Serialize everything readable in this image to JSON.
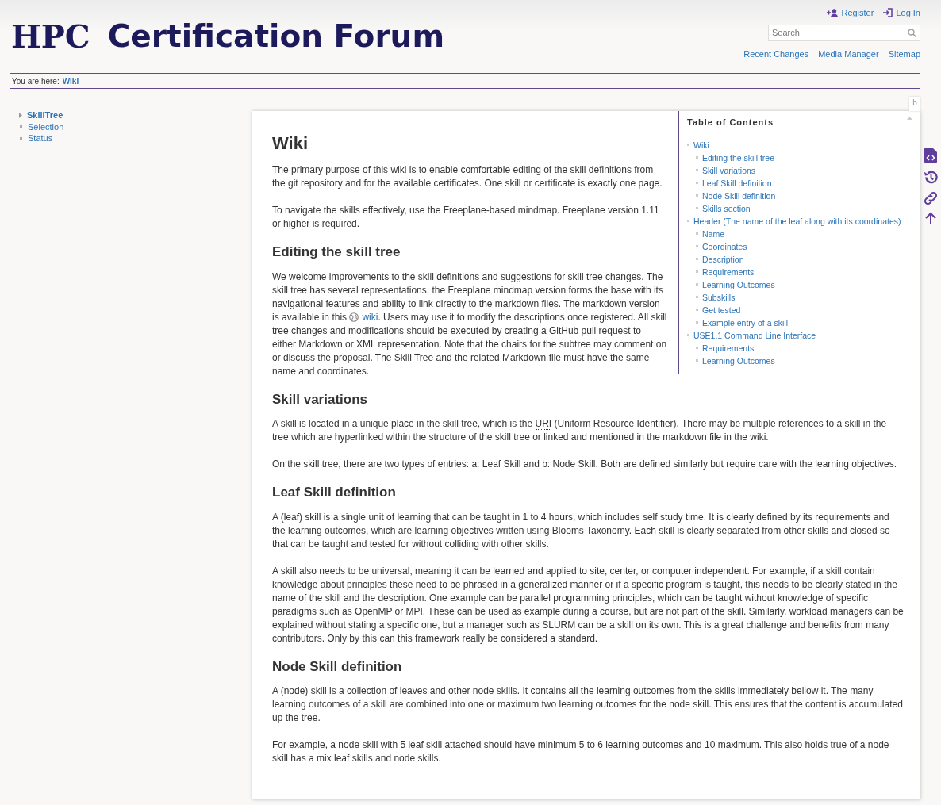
{
  "header": {
    "logo_left": "HPC",
    "logo_right": "Certification Forum",
    "user_tools": [
      {
        "label": "Register",
        "kind": "register"
      },
      {
        "label": "Log In",
        "kind": "login"
      }
    ],
    "search": {
      "placeholder": "Search"
    },
    "site_tools": [
      "Recent Changes",
      "Media Manager",
      "Sitemap"
    ]
  },
  "breadcrumb": {
    "label": "You are here:",
    "link": "Wiki"
  },
  "sidebar": {
    "items": [
      {
        "label": "SkillTree",
        "kind": "folder",
        "current": true
      },
      {
        "label": "Selection",
        "kind": "page",
        "current": false
      },
      {
        "label": "Status",
        "kind": "page",
        "current": false
      }
    ]
  },
  "page_tab": "b",
  "toc": {
    "title": "Table of Contents",
    "items": [
      {
        "label": "Wiki",
        "children": [
          {
            "label": "Editing the skill tree"
          },
          {
            "label": "Skill variations"
          },
          {
            "label": "Leaf Skill definition"
          },
          {
            "label": "Node Skill definition"
          },
          {
            "label": "Skills section"
          }
        ]
      },
      {
        "label": "Header (The name of the leaf along with its coordinates)",
        "children": [
          {
            "label": "Name"
          },
          {
            "label": "Coordinates"
          },
          {
            "label": "Description"
          },
          {
            "label": "Requirements"
          },
          {
            "label": "Learning Outcomes"
          },
          {
            "label": "Subskills"
          },
          {
            "label": "Get tested"
          },
          {
            "label": "Example entry of a skill"
          }
        ]
      },
      {
        "label": "USE1.1 Command Line Interface",
        "children": [
          {
            "label": "Requirements"
          },
          {
            "label": "Learning Outcomes"
          }
        ]
      }
    ]
  },
  "content": [
    {
      "kind": "h1",
      "text": "Wiki"
    },
    {
      "kind": "p",
      "parts": [
        {
          "kind": "text",
          "text": "The primary purpose of this wiki is to enable comfortable editing of the skill definitions from the git repository and for the available certificates. One skill or certificate is exactly one page."
        }
      ]
    },
    {
      "kind": "p",
      "parts": [
        {
          "kind": "text",
          "text": "To navigate the skills effectively, use the Freeplane-based mindmap. Freeplane version 1.11 or higher is required."
        }
      ]
    },
    {
      "kind": "h2",
      "text": "Editing the skill tree"
    },
    {
      "kind": "p",
      "parts": [
        {
          "kind": "text",
          "text": "We welcome improvements to the skill definitions and suggestions for skill tree changes. The skill tree has several representations, the Freeplane mindmap version forms the base with its navigational features and ability to link directly to the markdown files. The markdown version is available in this "
        },
        {
          "kind": "link",
          "text": "wiki"
        },
        {
          "kind": "text",
          "text": ". Users may use it to modify the descriptions once registered. All skill tree changes and modifications should be executed by creating a GitHub pull request to either Markdown or XML representation. Note that the chairs for the subtree may comment on or discuss the proposal. The Skill Tree and the related Markdown file must have the same name and coordinates."
        }
      ]
    },
    {
      "kind": "h2",
      "text": "Skill variations"
    },
    {
      "kind": "p",
      "parts": [
        {
          "kind": "text",
          "text": "A skill is located in a unique place in the skill tree, which is the "
        },
        {
          "kind": "abbr",
          "text": "URI"
        },
        {
          "kind": "text",
          "text": " (Uniform Resource Identifier). There may be multiple references to a skill in the tree which are hyperlinked within the structure of the skill tree or linked and mentioned in the markdown file in the wiki."
        }
      ]
    },
    {
      "kind": "p",
      "parts": [
        {
          "kind": "text",
          "text": "On the skill tree, there are two types of entries: a: Leaf Skill and b: Node Skill. Both are defined similarly but require care with the learning objectives."
        }
      ]
    },
    {
      "kind": "h2",
      "text": "Leaf Skill definition"
    },
    {
      "kind": "p",
      "parts": [
        {
          "kind": "text",
          "text": "A (leaf) skill is a single unit of learning that can be taught in 1 to 4 hours, which includes self study time. It is clearly defined by its requirements and the learning outcomes, which are learning objectives written using Blooms Taxonomy. Each skill is clearly separated from other skills and closed so that can be taught and tested for without colliding with other skills."
        }
      ]
    },
    {
      "kind": "p",
      "parts": [
        {
          "kind": "text",
          "text": "A skill also needs to be universal, meaning it can be learned and applied to site, center, or computer independent. For example, if a skill contain knowledge about principles these need to be phrased in a generalized manner or if a specific program is taught, this needs to be clearly stated in the name of the skill and the description. One example can be parallel programming principles, which can be taught without knowledge of specific paradigms such as OpenMP or MPI. These can be used as example during a course, but are not part of the skill. Similarly, workload managers can be explained without stating a specific one, but a manager such as SLURM can be a skill on its own. This is a great challenge and benefits from many contributors. Only by this can this framework really be considered a standard."
        }
      ]
    },
    {
      "kind": "h2",
      "text": "Node Skill definition"
    },
    {
      "kind": "p",
      "parts": [
        {
          "kind": "text",
          "text": "A (node) skill is a collection of leaves and other node skills. It contains all the learning outcomes from the skills immediately bellow it. The many learning outcomes of a skill are combined into one or maximum two learning outcomes for the node skill. This ensures that the content is accumulated up the tree."
        }
      ]
    },
    {
      "kind": "p",
      "parts": [
        {
          "kind": "text",
          "text": "For example, a node skill with 5 leaf skill attached should have minimum 5 to 6 learning outcomes and 10 maximum. This also holds true of a node skill has a mix leaf skills and node skills."
        }
      ]
    }
  ],
  "page_tools": [
    {
      "kind": "source"
    },
    {
      "kind": "revisions"
    },
    {
      "kind": "backlinks"
    },
    {
      "kind": "top"
    }
  ]
}
